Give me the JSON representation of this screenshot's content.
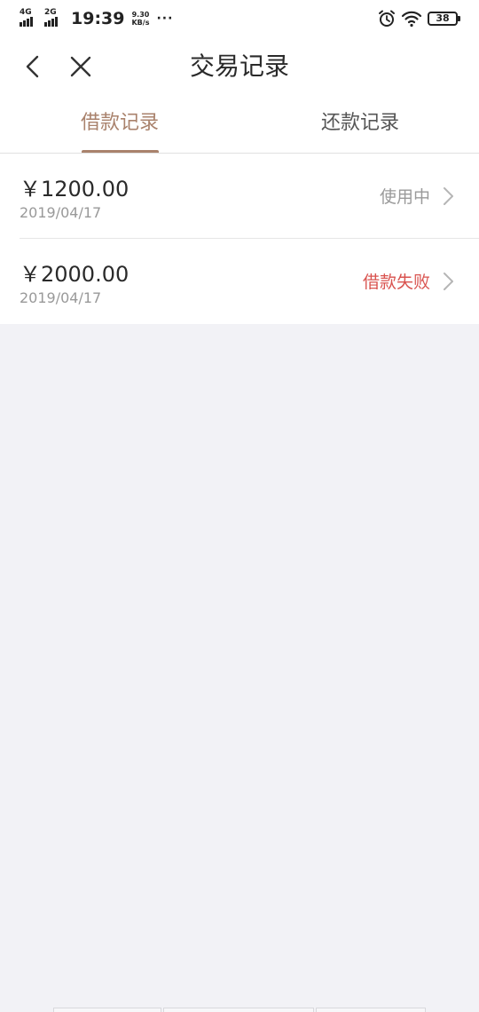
{
  "status_bar": {
    "network_1": "4G",
    "network_2": "2G",
    "time": "19:39",
    "speed_value": "9.30",
    "speed_unit": "KB/s",
    "more": "···",
    "battery": "38",
    "icons": [
      "alarm-icon",
      "wifi-icon",
      "battery-icon"
    ]
  },
  "nav": {
    "title": "交易记录",
    "back_icon": "chevron-left-icon",
    "close_icon": "close-icon"
  },
  "tabs": [
    {
      "label": "借款记录",
      "active": true
    },
    {
      "label": "还款记录",
      "active": false
    }
  ],
  "records": [
    {
      "amount": "￥1200.00",
      "date": "2019/04/17",
      "status": "使用中",
      "status_color": "#9a9a9a"
    },
    {
      "amount": "￥2000.00",
      "date": "2019/04/17",
      "status": "借款失败",
      "status_color": "#d9534f"
    }
  ],
  "colors": {
    "accent": "#a9826c",
    "fail": "#d9534f",
    "background": "#f2f2f6"
  }
}
